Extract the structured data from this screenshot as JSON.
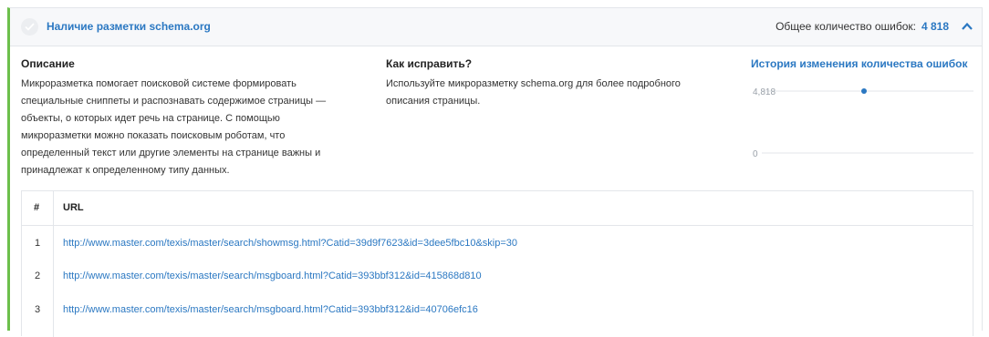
{
  "header": {
    "title": "Наличие разметки schema.org",
    "errors_label": "Общее количество ошибок:",
    "errors_count": "4 818"
  },
  "description": {
    "title": "Описание",
    "lines": [
      "Микроразметка помогает поисковой системе формировать",
      "специальные сниппеты и распознавать содержимое страницы —",
      "объекты, о которых идет речь на странице. С помощью",
      "микроразметки можно показать поисковым роботам, что",
      "определенный текст или другие элементы на странице важны и",
      "принадлежат к определенному типу данных."
    ]
  },
  "fix": {
    "title": "Как исправить?",
    "lines": [
      "Используйте микроразметку schema.org для более подробного",
      "описания страницы."
    ]
  },
  "history": {
    "title": "История изменения количества ошибок"
  },
  "chart_data": {
    "type": "line",
    "title": "История изменения количества ошибок",
    "y_ticks": [
      "4,818",
      "0"
    ],
    "ylim": [
      0,
      4818
    ],
    "series": [
      {
        "values": [
          4818
        ]
      }
    ],
    "grid": true,
    "point_color": "#2b78c2"
  },
  "table": {
    "headers": [
      "#",
      "URL"
    ],
    "rows": [
      {
        "num": "1",
        "url": "http://www.master.com/texis/master/search/showmsg.html?Catid=39d9f7623&id=3dee5fbc10&skip=30"
      },
      {
        "num": "2",
        "url": "http://www.master.com/texis/master/search/msgboard.html?Catid=393bbf312&id=415868d810"
      },
      {
        "num": "3",
        "url": "http://www.master.com/texis/master/search/msgboard.html?Catid=393bbf312&id=40706efc16"
      }
    ]
  },
  "colors": {
    "accent": "#2b78c2",
    "status_border": "#6cbf4b"
  },
  "icons": {
    "status": "check-circle-icon",
    "collapse": "chevron-up-icon"
  }
}
